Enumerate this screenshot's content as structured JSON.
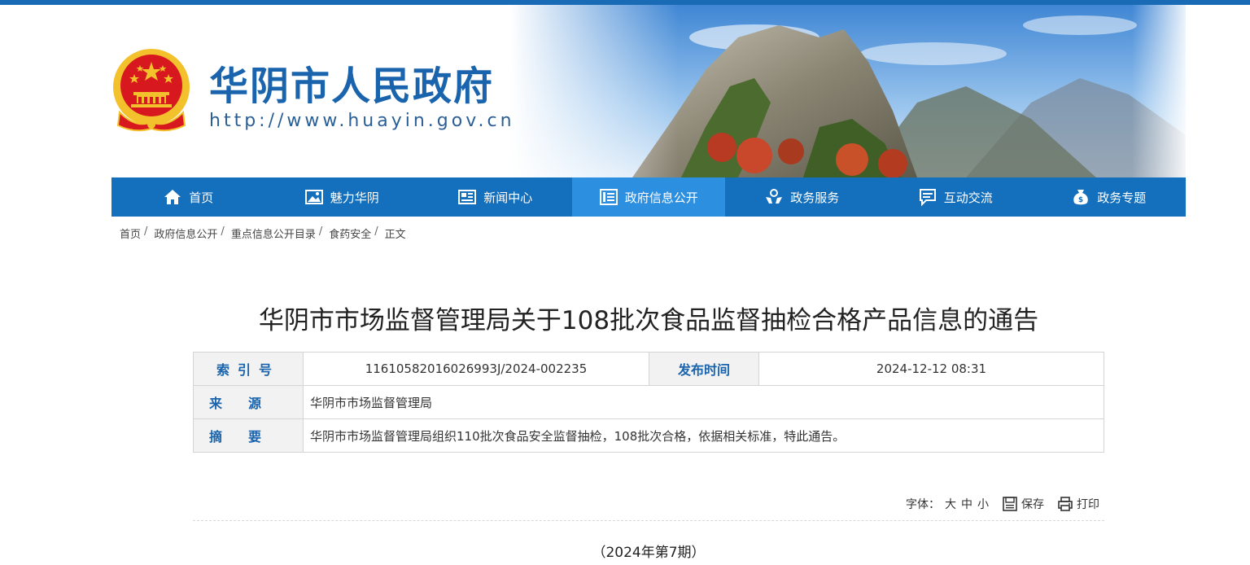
{
  "colors": {
    "brand": "#1470bd",
    "nav_active": "#2d8fe0",
    "title_blue": "#1a64ad",
    "emblem_red": "#d7191f",
    "emblem_gold": "#f3c12c"
  },
  "header": {
    "site_title": "华阴市人民政府",
    "site_url": "http://www.huayin.gov.cn"
  },
  "nav": {
    "items": [
      {
        "label": "首页",
        "icon": "home-icon"
      },
      {
        "label": "魅力华阴",
        "icon": "picture-icon"
      },
      {
        "label": "新闻中心",
        "icon": "newspaper-icon"
      },
      {
        "label": "政府信息公开",
        "icon": "document-list-icon"
      },
      {
        "label": "政务服务",
        "icon": "hands-service-icon"
      },
      {
        "label": "互动交流",
        "icon": "chat-icon"
      },
      {
        "label": "政务专题",
        "icon": "money-bag-icon"
      }
    ],
    "active_index": 3
  },
  "breadcrumb": {
    "items": [
      "首页",
      "政府信息公开",
      "重点信息公开目录",
      "食药安全"
    ],
    "current": "正文",
    "separator": "/"
  },
  "article": {
    "title": "华阴市市场监督管理局关于108批次食品监督抽检合格产品信息的通告",
    "info": {
      "index_label": "索引号",
      "index_value": "11610582016026993J/2024-002235",
      "date_label": "发布时间",
      "date_value": "2024-12-12 08:31",
      "source_label": "来源",
      "source_value": "华阴市市场监督管理局",
      "summary_label": "摘要",
      "summary_value": "华阴市市场监督管理局组织110批次食品安全监督抽检，108批次合格，依据相关标准，特此通告。"
    },
    "issue": "（2024年第7期）"
  },
  "tools": {
    "font_label": "字体：",
    "sizes": [
      "大",
      "中",
      "小"
    ],
    "save_label": "保存",
    "print_label": "打印"
  }
}
